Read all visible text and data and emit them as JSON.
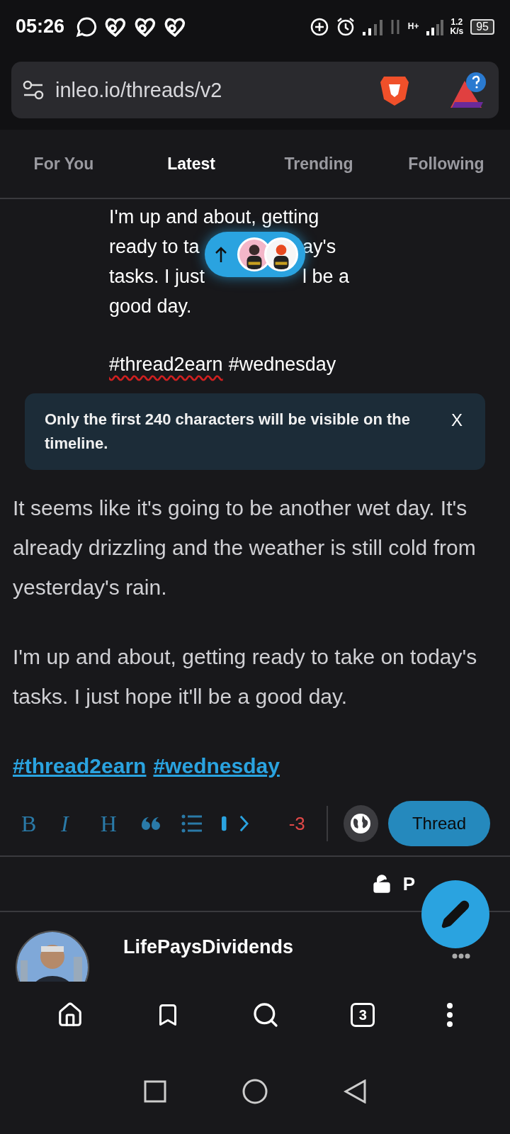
{
  "status_bar": {
    "time": "05:26",
    "speed_value": "1.2",
    "speed_unit": "K/s",
    "battery": "95",
    "network": "H+"
  },
  "address_bar": {
    "url": "inleo.io/threads/v2"
  },
  "tabs": [
    {
      "label": "For You",
      "selected": false
    },
    {
      "label": "Latest",
      "selected": true
    },
    {
      "label": "Trending",
      "selected": false
    },
    {
      "label": "Following",
      "selected": false
    }
  ],
  "preview": {
    "lines": [
      {
        "left": "I'm up and about, getting"
      },
      {
        "left": "ready to ta",
        "right": "ay's"
      },
      {
        "left": "tasks. I just",
        "right": "l be a"
      },
      {
        "left": "good day."
      }
    ],
    "hashtags": [
      {
        "text": "#thread2earn",
        "misspelled": true
      },
      {
        "text": "#wednesday",
        "misspelled": false
      }
    ]
  },
  "notice": {
    "text": "Only the first 240 characters will be visible on the timeline.",
    "close": "X"
  },
  "editor": {
    "paragraphs": [
      "It seems like it's going to be another wet day. It's already drizzling and the weather is still cold from yesterday's rain.",
      "I'm up and about, getting ready to take on today's tasks. I just hope it'll be a good day."
    ],
    "hashtags": [
      "#thread2earn",
      "#wednesday"
    ]
  },
  "toolbar": {
    "format_buttons": [
      {
        "label": "B",
        "kind": "bold"
      },
      {
        "label": "I",
        "kind": "italic"
      },
      {
        "label": "H",
        "kind": "heading"
      }
    ],
    "counter": "-3",
    "submit": "Thread"
  },
  "privacy": {
    "label": "P"
  },
  "post": {
    "author": "LifePaysDividends"
  },
  "bottom_nav": {
    "tab_count": "3"
  }
}
